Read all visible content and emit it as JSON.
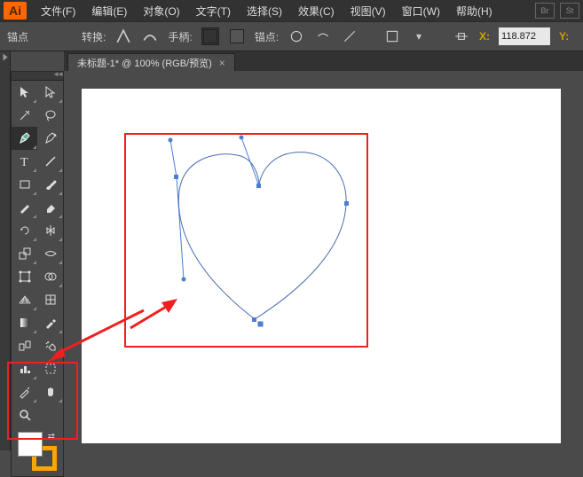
{
  "app": {
    "logo": "Ai"
  },
  "menu": {
    "file": "文件(F)",
    "edit": "编辑(E)",
    "object": "对象(O)",
    "type": "文字(T)",
    "select": "选择(S)",
    "effect": "效果(C)",
    "view": "视图(V)",
    "window": "窗口(W)",
    "help": "帮助(H)"
  },
  "menu_right": {
    "br": "Br",
    "st": "St"
  },
  "control": {
    "anchor_label": "锚点",
    "convert_label": "转换:",
    "handle_label": "手柄:",
    "anchors_label": "锚点:",
    "x_label": "X:",
    "y_label": "Y:",
    "x_value": "118.872"
  },
  "tab": {
    "title": "未标题-1* @ 100% (RGB/预览)"
  },
  "colors": {
    "fill": "#ffffff",
    "stroke": "#ffa500"
  }
}
